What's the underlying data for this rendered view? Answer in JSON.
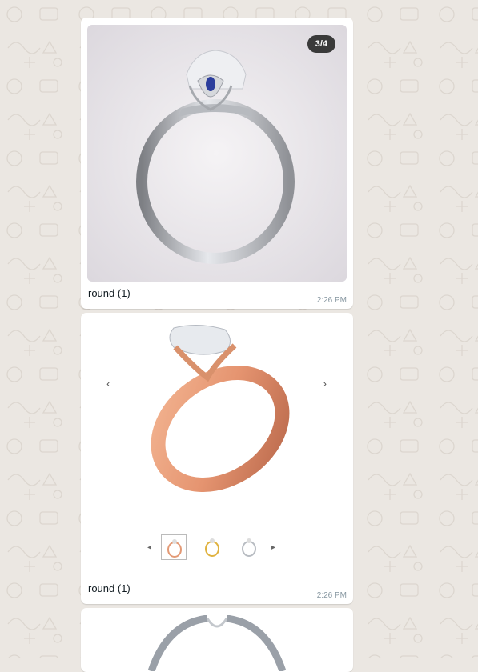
{
  "messages": [
    {
      "caption": "round (1)",
      "time": "2:26 PM",
      "counter": "3/4",
      "image": "ring-side-view-sapphire"
    },
    {
      "caption": "round (1)",
      "time": "2:26 PM",
      "image": "rose-gold-ring",
      "nav": {
        "prev": "‹",
        "next": "›"
      },
      "thumbnails": [
        "rose-gold-ring",
        "yellow-gold-ring",
        "white-gold-ring"
      ]
    },
    {
      "image": "white-gold-ring-partial"
    }
  ],
  "colors": {
    "wallpaper": "#ebe7e2",
    "bubble": "#ffffff",
    "timestamp": "#8696a0",
    "rose_gold": "#e9a07a",
    "platinum": "#c9ccd1",
    "sapphire": "#2b3d9c"
  }
}
